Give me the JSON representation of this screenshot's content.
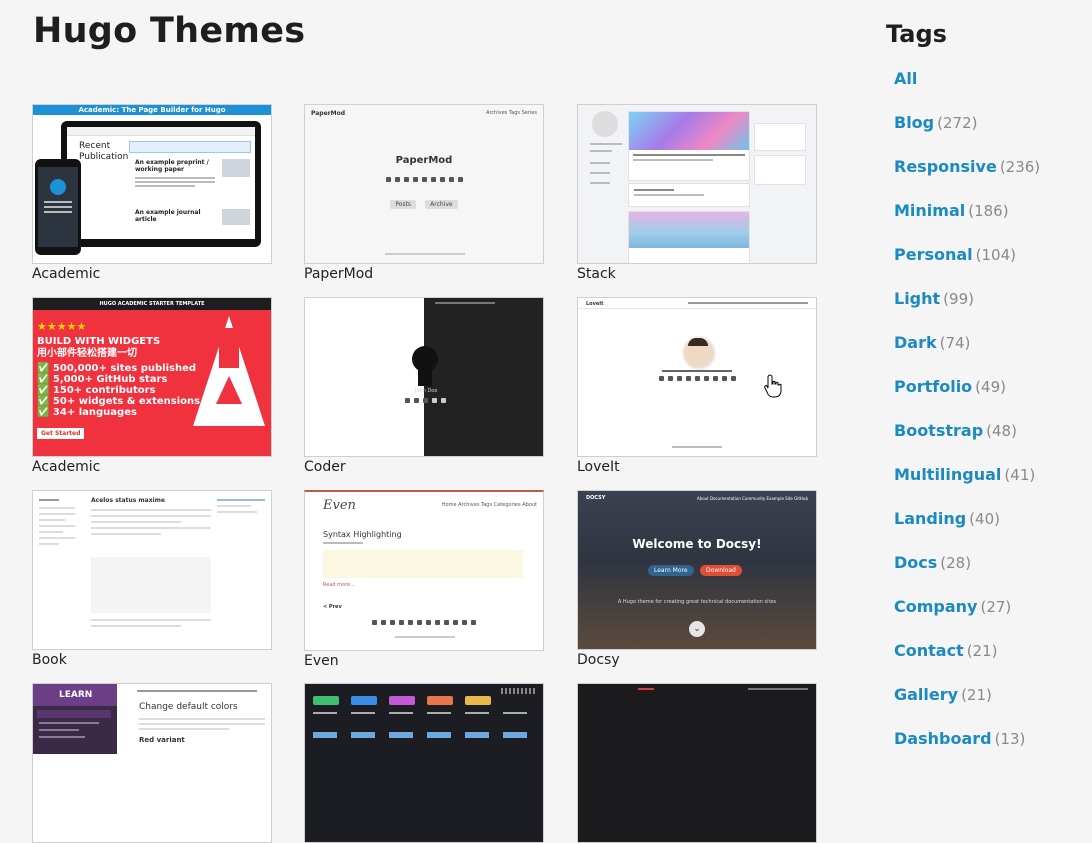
{
  "page": {
    "title": "Hugo Themes"
  },
  "themes": [
    {
      "name": "Academic"
    },
    {
      "name": "PaperMod"
    },
    {
      "name": "Stack"
    },
    {
      "name": "Academic"
    },
    {
      "name": "Coder"
    },
    {
      "name": "LoveIt"
    },
    {
      "name": "Book"
    },
    {
      "name": "Even"
    },
    {
      "name": "Docsy"
    }
  ],
  "thumbs": {
    "academic1_banner": "Academic: The Page Builder for Hugo",
    "academic1_recent": "Recent Publication",
    "academic1_post1": "An example preprint / working paper",
    "academic1_post2": "An example journal article",
    "papermod_logo": "PaperMod",
    "papermod_nav": "Archives  Tags  Series",
    "papermod_title": "PaperMod",
    "papermod_btn1": "Posts",
    "papermod_btn2": "Archive",
    "academic2_header": "HUGO ACADEMIC STARTER TEMPLATE",
    "academic2_stars": "★★★★★",
    "academic2_line1": "BUILD WITH WIDGETS",
    "academic2_line2": "用小部件轻松搭建一切",
    "academic2_items": [
      "✅ 500,000+ sites published",
      "✅ 5,000+ GitHub stars",
      "✅ 150+ contributors",
      "✅ 50+ widgets & extensions",
      "✅ 34+ languages"
    ],
    "academic2_cta": "Get Started",
    "even_logo": "Even",
    "even_nav": "Home  Archives  Tags  Categories  About",
    "even_post": "Syntax Highlighting",
    "even_readmore": "Read more...",
    "even_prev": "< Prev",
    "docsy_logo": "DOCSY",
    "docsy_nav": "About  Documentation  Community  Example Site  GitHub",
    "docsy_welcome": "Welcome to Docsy!",
    "docsy_btn1": "Learn More",
    "docsy_btn2": "Download",
    "docsy_sub": "A Hugo theme for creating great technical documentation sites",
    "book_title": "Acelos status maxime",
    "loveit_logo": "LoveIt",
    "coder_name": "John Doe",
    "learn_logo": "LEARN",
    "learn_heading": "Change default colors",
    "learn_sub": "Red variant"
  },
  "sidebar": {
    "title": "Tags",
    "tags": [
      {
        "name": "All",
        "count": ""
      },
      {
        "name": "Blog",
        "count": "(272)"
      },
      {
        "name": "Responsive",
        "count": "(236)"
      },
      {
        "name": "Minimal",
        "count": "(186)"
      },
      {
        "name": "Personal",
        "count": "(104)"
      },
      {
        "name": "Light",
        "count": "(99)"
      },
      {
        "name": "Dark",
        "count": "(74)"
      },
      {
        "name": "Portfolio",
        "count": "(49)"
      },
      {
        "name": "Bootstrap",
        "count": "(48)"
      },
      {
        "name": "Multilingual",
        "count": "(41)"
      },
      {
        "name": "Landing",
        "count": "(40)"
      },
      {
        "name": "Docs",
        "count": "(28)"
      },
      {
        "name": "Company",
        "count": "(27)"
      },
      {
        "name": "Contact",
        "count": "(21)"
      },
      {
        "name": "Gallery",
        "count": "(21)"
      },
      {
        "name": "Dashboard",
        "count": "(13)"
      }
    ]
  }
}
